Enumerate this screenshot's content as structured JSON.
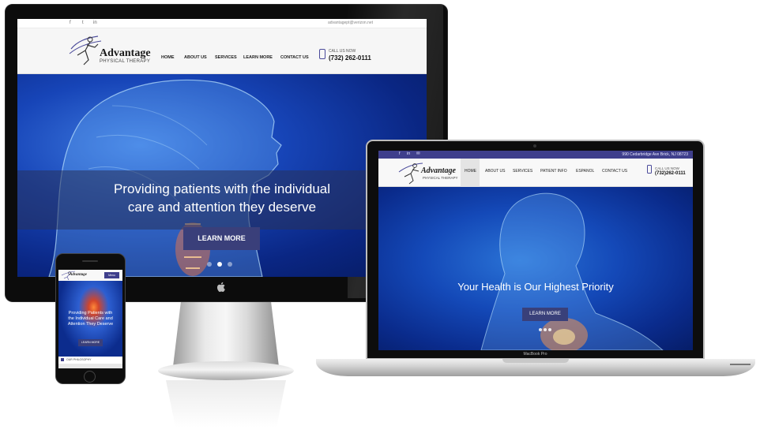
{
  "brand": {
    "name": "Advantage",
    "subtitle": "PHYSICAL THERAPY",
    "accent": "#3f3f8c"
  },
  "desktop": {
    "social_icons": [
      "facebook-icon",
      "twitter-icon",
      "linkedin-icon"
    ],
    "social_glyphs": [
      "f",
      "t",
      "in"
    ],
    "email": "advantagept@verizon.net",
    "nav": [
      "HOME",
      "ABOUT US",
      "SERVICES",
      "LEARN MORE",
      "CONTACT US"
    ],
    "call_label": "CALL US NOW",
    "phone": "(732) 262-0111",
    "hero_line1": "Providing patients with the individual",
    "hero_line2": "care and attention they deserve",
    "hero_button": "LEARN MORE",
    "slide_count": 3,
    "active_slide": 2
  },
  "laptop": {
    "social_glyphs": [
      "f",
      "in",
      "✉"
    ],
    "address": "990 Cedarbridge Ave Brick, NJ 08723",
    "nav": [
      "HOME",
      "ABOUT US",
      "SERVICES",
      "PATIENT INFO",
      "ESPANOL",
      "CONTACT US"
    ],
    "call_label": "CALL US NOW",
    "phone": "(732)262-0111",
    "hero_text": "Your Health is Our Highest Priority",
    "hero_button": "LEARN MORE",
    "device_label": "MacBook Pro"
  },
  "mobile": {
    "menu_label": "Menu",
    "hero_line1": "Providing Patients with",
    "hero_line2": "the Individual Care and",
    "hero_line3": "Attention They Deserve",
    "hero_button": "LEARN MORE",
    "section_label": "OUR PHILOSOPHY"
  }
}
